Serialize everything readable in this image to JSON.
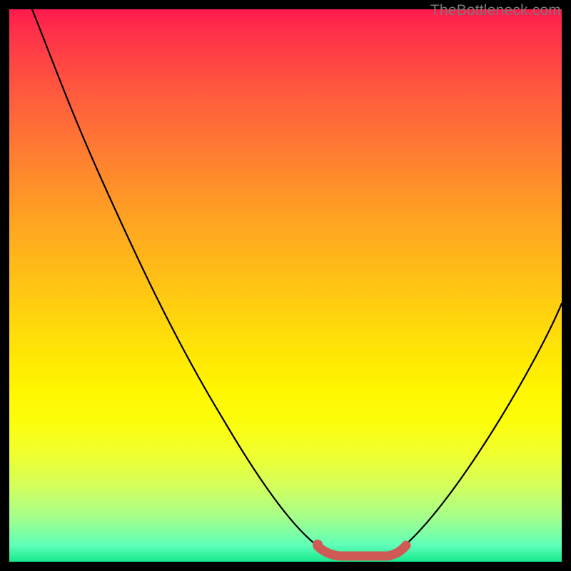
{
  "watermark": "TheBottleneck.com",
  "colors": {
    "gradient_top": "#ff1a4d",
    "gradient_mid": "#ffe008",
    "gradient_bottom": "#17e88f",
    "curve": "#000000",
    "highlight": "#cf5a55",
    "background_border": "#000000"
  },
  "chart_data": {
    "type": "line",
    "title": "",
    "xlabel": "",
    "ylabel": "",
    "xlim": [
      0,
      100
    ],
    "ylim": [
      0,
      100
    ],
    "grid": false,
    "legend": false,
    "annotations": [],
    "series": [
      {
        "name": "bottleneck-curve",
        "x": [
          4,
          12,
          20,
          28,
          36,
          44,
          52,
          56,
          60,
          64,
          68,
          72,
          76,
          84,
          92,
          100
        ],
        "y": [
          100,
          86,
          72,
          58,
          44,
          30,
          16,
          6,
          1,
          0,
          0,
          2,
          6,
          18,
          34,
          47
        ]
      },
      {
        "name": "optimal-range-highlight",
        "x": [
          56,
          60,
          64,
          68,
          72
        ],
        "y": [
          3,
          1,
          0,
          0,
          2
        ],
        "style": "thick",
        "color": "#cf5a55"
      }
    ],
    "background": {
      "type": "vertical-gradient",
      "stops": [
        {
          "pos": 0.0,
          "color": "#ff1a4d"
        },
        {
          "pos": 0.5,
          "color": "#ffc414"
        },
        {
          "pos": 0.8,
          "color": "#f2ff2c"
        },
        {
          "pos": 1.0,
          "color": "#17e88f"
        }
      ],
      "meaning": "top=high bottleneck, bottom=low bottleneck"
    }
  }
}
